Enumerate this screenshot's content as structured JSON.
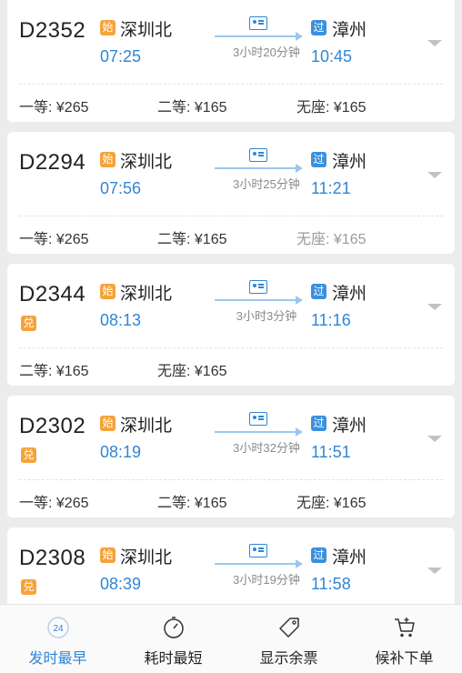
{
  "trains": [
    {
      "no": "D2352",
      "from_badge": "始",
      "from": "深圳北",
      "dep": "07:25",
      "duration": "3小时20分钟",
      "to_badge": "过",
      "to": "漳州",
      "arr": "10:45",
      "extra_badge": "",
      "prices": [
        {
          "label": "一等: ¥265",
          "dim": false
        },
        {
          "label": "二等: ¥165",
          "dim": false
        },
        {
          "label": "无座: ¥165",
          "dim": false
        }
      ]
    },
    {
      "no": "D2294",
      "from_badge": "始",
      "from": "深圳北",
      "dep": "07:56",
      "duration": "3小时25分钟",
      "to_badge": "过",
      "to": "漳州",
      "arr": "11:21",
      "extra_badge": "",
      "prices": [
        {
          "label": "一等: ¥265",
          "dim": false
        },
        {
          "label": "二等: ¥165",
          "dim": false
        },
        {
          "label": "无座: ¥165",
          "dim": true
        }
      ]
    },
    {
      "no": "D2344",
      "from_badge": "始",
      "from": "深圳北",
      "dep": "08:13",
      "duration": "3小时3分钟",
      "to_badge": "过",
      "to": "漳州",
      "arr": "11:16",
      "extra_badge": "兑",
      "prices": [
        {
          "label": "二等: ¥165",
          "dim": false
        },
        {
          "label": "无座: ¥165",
          "dim": false
        }
      ]
    },
    {
      "no": "D2302",
      "from_badge": "始",
      "from": "深圳北",
      "dep": "08:19",
      "duration": "3小时32分钟",
      "to_badge": "过",
      "to": "漳州",
      "arr": "11:51",
      "extra_badge": "兑",
      "prices": [
        {
          "label": "一等: ¥265",
          "dim": false
        },
        {
          "label": "二等: ¥165",
          "dim": false
        },
        {
          "label": "无座: ¥165",
          "dim": false
        }
      ]
    },
    {
      "no": "D2308",
      "from_badge": "始",
      "from": "深圳北",
      "dep": "08:39",
      "duration": "3小时19分钟",
      "to_badge": "过",
      "to": "漳州",
      "arr": "11:58",
      "extra_badge": "兑",
      "prices": []
    }
  ],
  "tabbar": {
    "items": [
      {
        "label": "发时最早",
        "icon": "clock-24-icon",
        "active": true
      },
      {
        "label": "耗时最短",
        "icon": "stopwatch-icon",
        "active": false
      },
      {
        "label": "显示余票",
        "icon": "ticket-tag-icon",
        "active": false
      },
      {
        "label": "候补下单",
        "icon": "cart-plus-icon",
        "active": false
      }
    ],
    "clock_text": "24"
  },
  "colors": {
    "accent": "#2f86d6",
    "orange_badge": "#f5a33a",
    "blue_badge": "#3a8fde"
  }
}
